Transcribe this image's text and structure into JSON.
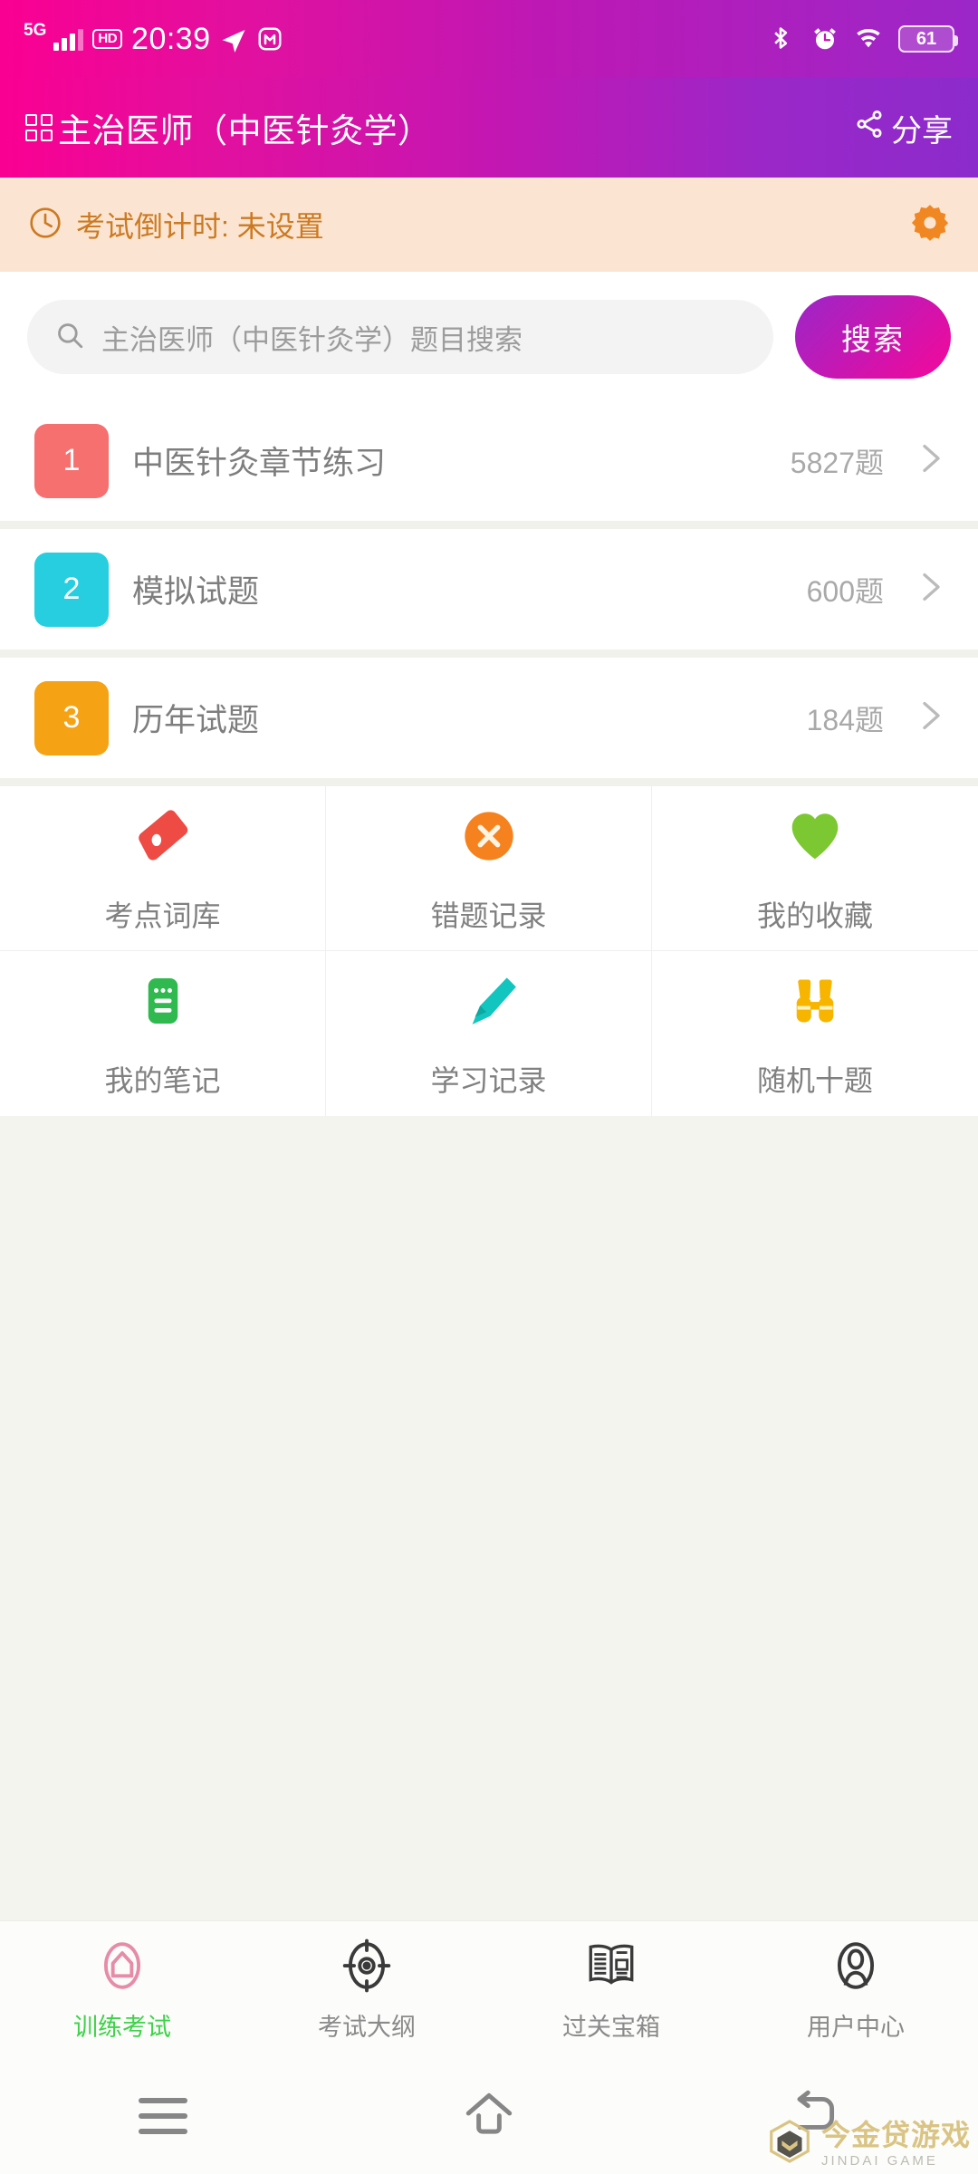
{
  "status_bar": {
    "network_label": "5G",
    "hd_label": "HD",
    "time": "20:39",
    "location_icon": "location-arrow-icon",
    "app_icon": "m-app-icon",
    "bluetooth_icon": "bluetooth-icon",
    "alarm_icon": "alarm-clock-icon",
    "wifi_icon": "wifi-icon",
    "battery_level": "61"
  },
  "header": {
    "menu_icon": "grid-menu-icon",
    "title": "主治医师（中医针灸学）",
    "share_label": "分享",
    "share_icon": "share-icon",
    "gradient_start": "#FA0092",
    "gradient_end": "#8C2BCC"
  },
  "countdown": {
    "clock_icon": "clock-icon",
    "text": "考试倒计时: 未设置",
    "settings_icon": "gear-icon",
    "background": "#FBE5D2",
    "text_color": "#CC7A22"
  },
  "search": {
    "search_icon": "search-icon",
    "placeholder": "主治医师（中医针灸学）题目搜索",
    "value": "",
    "button_label": "搜索"
  },
  "list": {
    "items": [
      {
        "number": "1",
        "label": "中医针灸章节练习",
        "count": "5827题",
        "color": "#F5706E",
        "chevron_icon": "chevron-right-icon"
      },
      {
        "number": "2",
        "label": "模拟试题",
        "count": "600题",
        "color": "#27CEE0",
        "chevron_icon": "chevron-right-icon"
      },
      {
        "number": "3",
        "label": "历年试题",
        "count": "184题",
        "color": "#F5A314",
        "chevron_icon": "chevron-right-icon"
      }
    ]
  },
  "feature_grid": {
    "items": [
      {
        "label": "考点词库",
        "icon": "tag-icon",
        "color": "#EE4B45"
      },
      {
        "label": "错题记录",
        "icon": "error-x-icon",
        "color": "#F5821F"
      },
      {
        "label": "我的收藏",
        "icon": "heart-icon",
        "color": "#7CC832"
      },
      {
        "label": "我的笔记",
        "icon": "note-icon",
        "color": "#2FB94E"
      },
      {
        "label": "学习记录",
        "icon": "pencil-icon",
        "color": "#12C5BE"
      },
      {
        "label": "随机十题",
        "icon": "binoculars-icon",
        "color": "#F7B500"
      }
    ]
  },
  "tab_bar": {
    "items": [
      {
        "label": "训练考试",
        "icon": "home-icon",
        "active": true,
        "icon_color": "#E78CA8",
        "label_color": "#3FD24A"
      },
      {
        "label": "考试大纲",
        "icon": "target-icon",
        "active": false,
        "icon_color": "#3A3A3A",
        "label_color": "#8A8A8A"
      },
      {
        "label": "过关宝箱",
        "icon": "book-news-icon",
        "active": false,
        "icon_color": "#3A3A3A",
        "label_color": "#8A8A8A"
      },
      {
        "label": "用户中心",
        "icon": "user-icon",
        "active": false,
        "icon_color": "#3A3A3A",
        "label_color": "#8A8A8A"
      }
    ]
  },
  "nav_bar": {
    "recents_icon": "menu-lines-icon",
    "home_icon": "home-outline-icon",
    "back_icon": "back-arrow-icon"
  },
  "watermark": {
    "cn": "今金贷游戏",
    "en": "JINDAI GAME",
    "logo_icon": "shield-logo-icon"
  }
}
